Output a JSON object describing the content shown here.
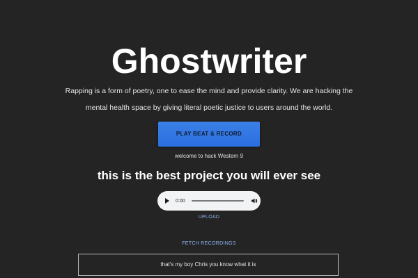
{
  "header": {
    "title": "Ghostwriter",
    "description": "Rapping is a form of poetry, one to ease the mind and provide clarity. We are hacking the mental health space by giving literal poetic justice to users around the world."
  },
  "actions": {
    "play_record_label": "PLAY BEAT & RECORD",
    "welcome_text": "welcome to hack Western 9",
    "tagline": "this is the best project you will ever see",
    "upload_label": "UPLOAD",
    "fetch_label": "FETCH RECORDINGS"
  },
  "audio_player": {
    "current_time": "0:00",
    "progress": 0,
    "icons": [
      "play-icon",
      "volume-icon"
    ]
  },
  "recordings": [
    {
      "text": "that's my boy Chris you know what it is"
    }
  ],
  "colors": {
    "background": "#242424",
    "button": "#2a6fe0",
    "link": "#8fb4f0"
  }
}
